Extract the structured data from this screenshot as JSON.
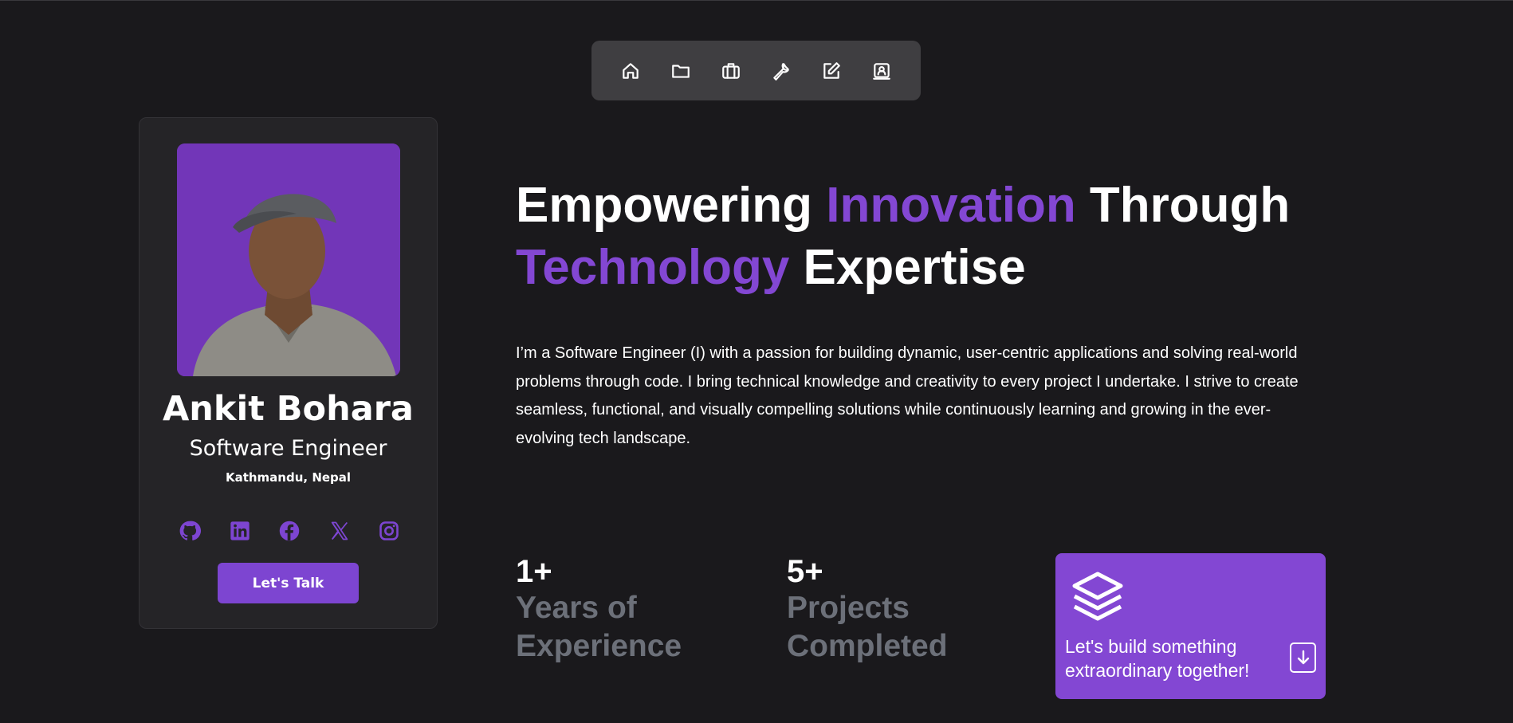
{
  "nav": {
    "items": [
      {
        "name": "home",
        "icon": "home-icon"
      },
      {
        "name": "projects",
        "icon": "folder-icon"
      },
      {
        "name": "experience",
        "icon": "briefcase-icon"
      },
      {
        "name": "skills",
        "icon": "wrench-icon"
      },
      {
        "name": "blog",
        "icon": "edit-icon"
      },
      {
        "name": "contact",
        "icon": "contact-card-icon"
      }
    ]
  },
  "profile": {
    "name": "Ankit Bohara",
    "role": "Software Engineer",
    "location": "Kathmandu, Nepal",
    "socials": [
      "github-icon",
      "linkedin-icon",
      "facebook-icon",
      "x-icon",
      "instagram-icon"
    ],
    "cta_label": "Let's Talk"
  },
  "hero": {
    "headline_1": "Empowering ",
    "headline_2": "Innovation",
    "headline_3": " Through",
    "headline_4": "Technology",
    "headline_5": " Expertise",
    "bio": "I’m a Software Engineer (I) with a passion for building dynamic, user-centric applications and solving real-world problems through code. I bring technical knowledge and creativity to every project I undertake. I strive to create seamless, functional, and visually compelling solutions while continuously learning and growing in the ever-evolving tech landscape."
  },
  "stats": [
    {
      "value": "1+",
      "label_line1": "Years of",
      "label_line2": "Experience"
    },
    {
      "value": "5+",
      "label_line1": "Projects",
      "label_line2": "Completed"
    }
  ],
  "cta_card": {
    "text_line1": "Let's build something",
    "text_line2": "extraordinary together!"
  },
  "colors": {
    "background": "#1a191c",
    "accent": "#8347d3",
    "card": "#252427",
    "muted": "#6c7079"
  }
}
